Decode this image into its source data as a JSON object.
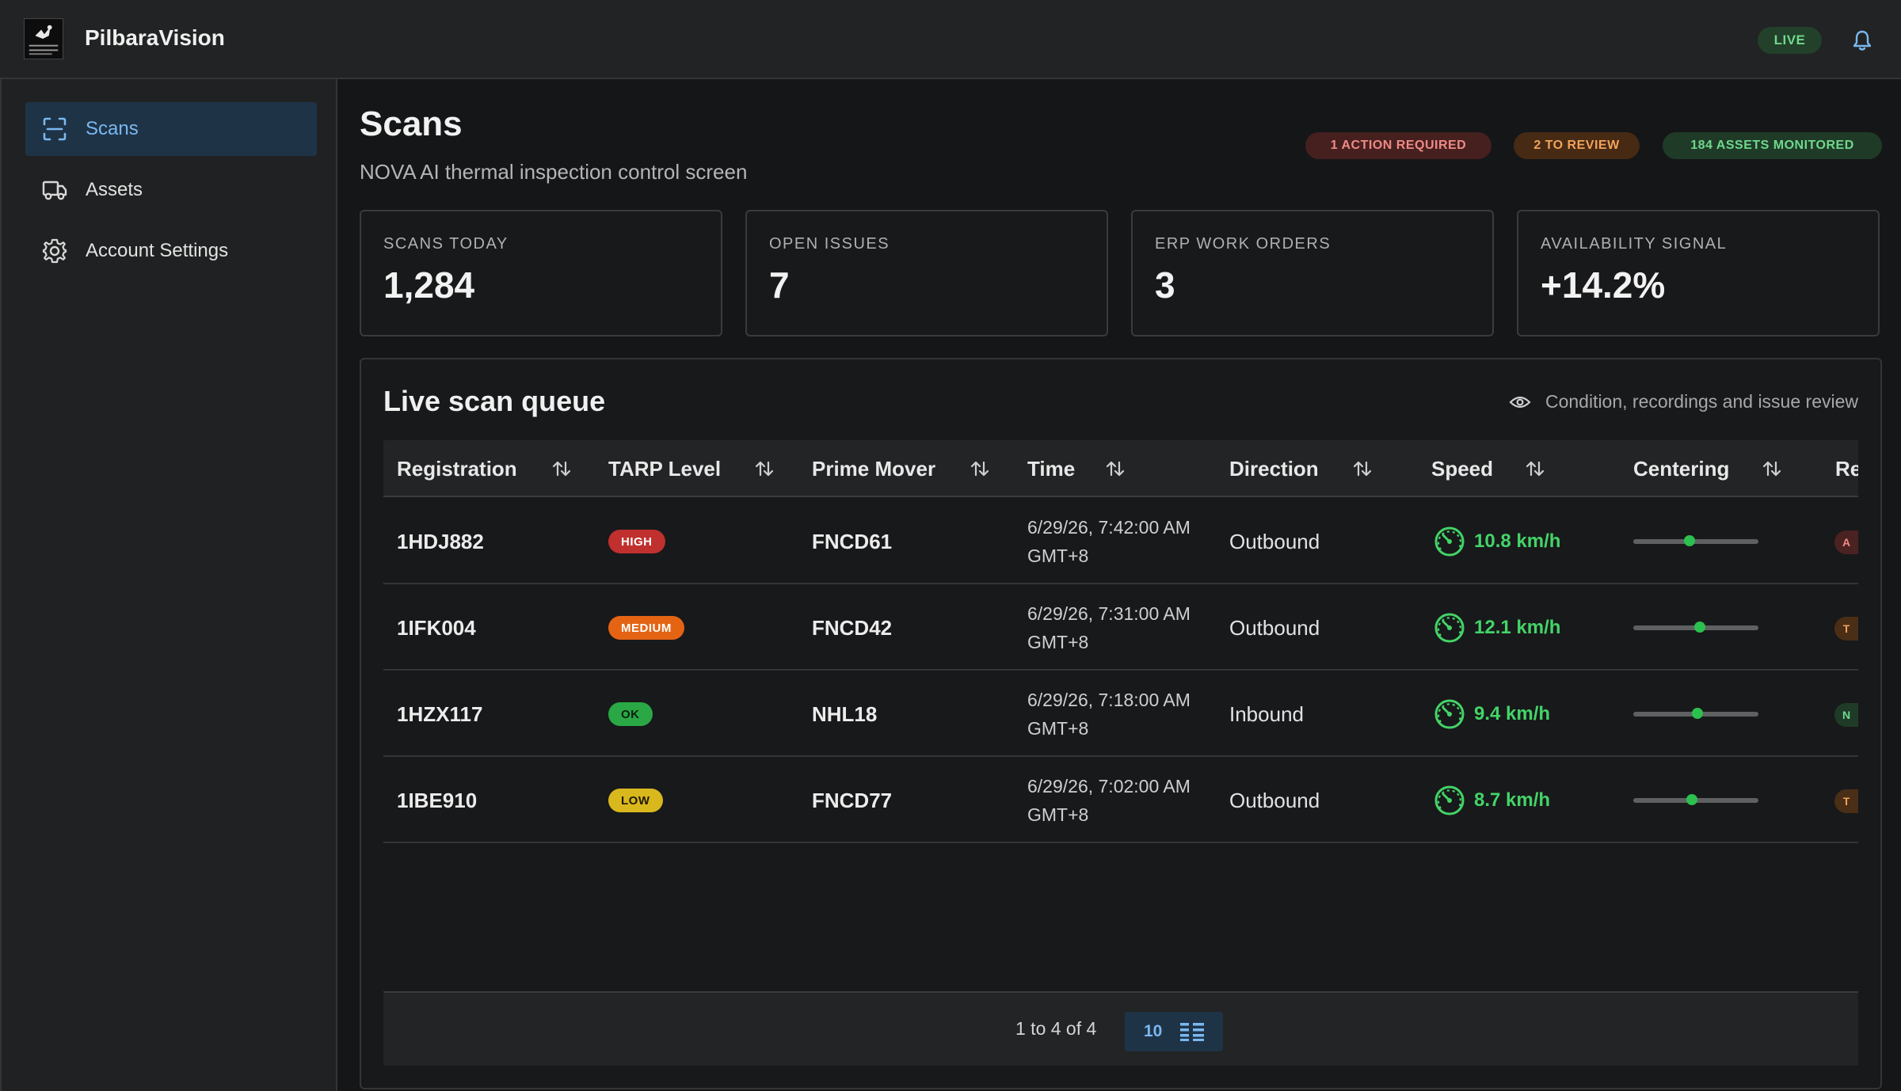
{
  "app": {
    "title": "PilbaraVision",
    "live_label": "LIVE"
  },
  "sidebar": {
    "items": [
      {
        "label": "Scans",
        "icon": "scan-icon",
        "active": true
      },
      {
        "label": "Assets",
        "icon": "truck-icon",
        "active": false
      },
      {
        "label": "Account Settings",
        "icon": "gear-icon",
        "active": false
      }
    ]
  },
  "page": {
    "title": "Scans",
    "subtitle": "NOVA AI thermal inspection control screen",
    "badges": {
      "action": "1 ACTION REQUIRED",
      "review": "2 TO REVIEW",
      "assets": "184 ASSETS MONITORED"
    }
  },
  "kpis": [
    {
      "label": "SCANS TODAY",
      "value": "1,284"
    },
    {
      "label": "OPEN ISSUES",
      "value": "7"
    },
    {
      "label": "ERP WORK ORDERS",
      "value": "3"
    },
    {
      "label": "AVAILABILITY SIGNAL",
      "value": "+14.2%"
    }
  ],
  "queue": {
    "title": "Live scan queue",
    "hint": "Condition, recordings and issue review",
    "columns": {
      "registration": "Registration",
      "tarp": "TARP Level",
      "prime_mover": "Prime Mover",
      "time": "Time",
      "direction": "Direction",
      "speed": "Speed",
      "centering": "Centering",
      "re": "Re"
    },
    "rows": [
      {
        "registration": "1HDJ882",
        "tarp": "HIGH",
        "prime_mover": "FNCD61",
        "time_line1": "6/29/26, 7:42:00 AM",
        "time_line2": "GMT+8",
        "direction": "Outbound",
        "speed": "10.8 km/h",
        "centering": 0.45,
        "re": "A",
        "re_color": "#4a2222",
        "re_text_color": "#f08a86"
      },
      {
        "registration": "1IFK004",
        "tarp": "MEDIUM",
        "prime_mover": "FNCD42",
        "time_line1": "6/29/26, 7:31:00 AM",
        "time_line2": "GMT+8",
        "direction": "Outbound",
        "speed": "12.1 km/h",
        "centering": 0.53,
        "re": "T",
        "re_color": "#4a2e16",
        "re_text_color": "#f2a25a"
      },
      {
        "registration": "1HZX117",
        "tarp": "OK",
        "prime_mover": "NHL18",
        "time_line1": "6/29/26, 7:18:00 AM",
        "time_line2": "GMT+8",
        "direction": "Inbound",
        "speed": "9.4 km/h",
        "centering": 0.51,
        "re": "N",
        "re_color": "#1f3b28",
        "re_text_color": "#6fd88c"
      },
      {
        "registration": "1IBE910",
        "tarp": "LOW",
        "prime_mover": "FNCD77",
        "time_line1": "6/29/26, 7:02:00 AM",
        "time_line2": "GMT+8",
        "direction": "Outbound",
        "speed": "8.7 km/h",
        "centering": 0.47,
        "re": "T",
        "re_color": "#4a2e16",
        "re_text_color": "#f2a25a"
      }
    ],
    "footer": {
      "range_text": "1 to 4 of 4",
      "page_size": "10"
    }
  },
  "colors": {
    "accent": "#7ab8f0",
    "success": "#43d467",
    "high": "#c0302e",
    "medium": "#e46414",
    "ok": "#2aa845",
    "low": "#d9b81e"
  }
}
